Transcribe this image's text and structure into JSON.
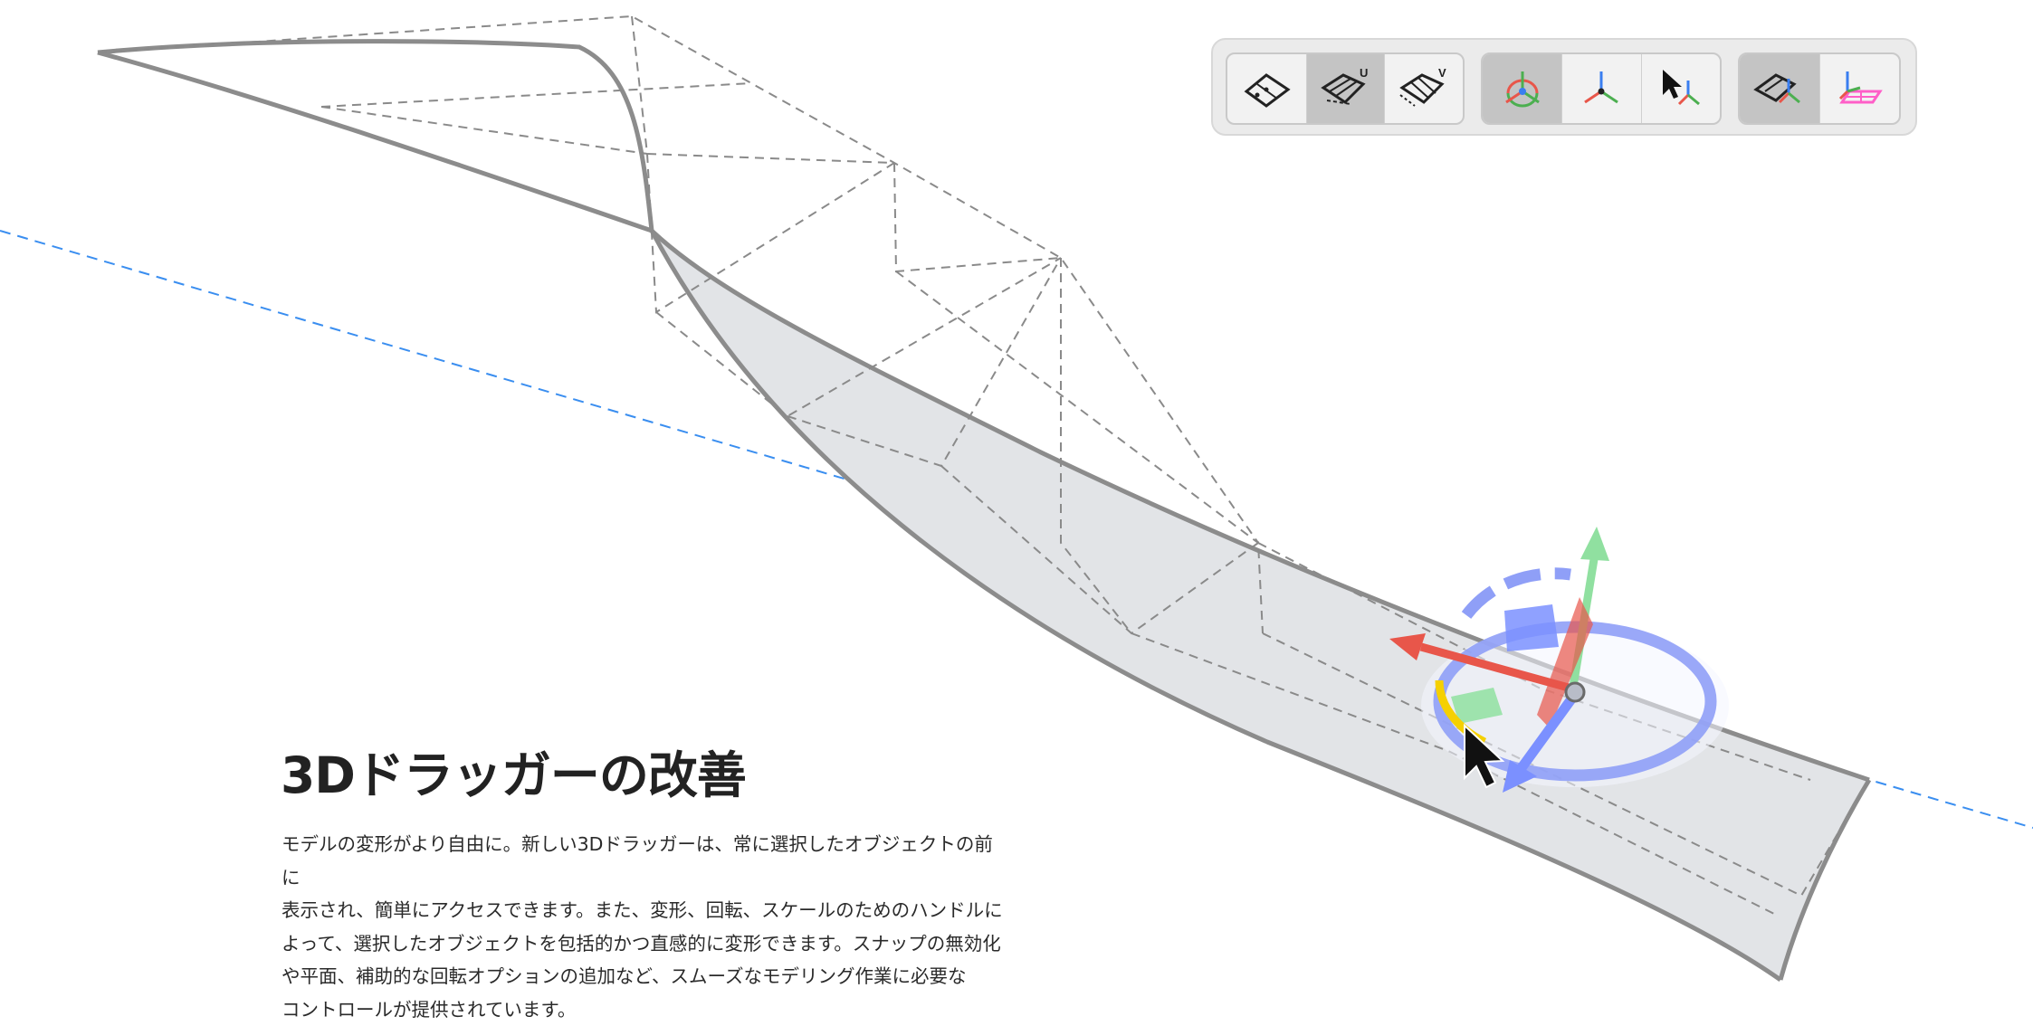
{
  "toolbar": {
    "groups": [
      {
        "name": "surface-edit",
        "buttons": [
          {
            "icon": "surface-control-points-icon",
            "active": false
          },
          {
            "icon": "surface-u-isocurve-icon",
            "active": true,
            "badge": "U"
          },
          {
            "icon": "surface-v-isocurve-icon",
            "active": false,
            "badge": "V"
          }
        ]
      },
      {
        "name": "gizmo-mode",
        "buttons": [
          {
            "icon": "full-gizmo-icon",
            "active": true
          },
          {
            "icon": "axis-gizmo-icon",
            "active": false
          },
          {
            "icon": "pointer-gizmo-icon",
            "active": false
          }
        ]
      },
      {
        "name": "gizmo-alignment",
        "buttons": [
          {
            "icon": "object-align-gizmo-icon",
            "active": true
          },
          {
            "icon": "plane-align-gizmo-icon",
            "active": false
          }
        ]
      }
    ]
  },
  "feature": {
    "title": "3Dドラッガーの改善",
    "description_lines": [
      "モデルの変形がより自由に。新しい3Dドラッガーは、常に選択したオブジェクトの前に",
      "表示され、簡単にアクセスできます。また、変形、回転、スケールのためのハンドルに",
      "よって、選択したオブジェクトを包括的かつ直感的に変形できます。スナップの無効化",
      "や平面、補助的な回転オプションの追加など、スムーズなモデリング作業に必要な",
      "コントロールが提供されています。"
    ]
  },
  "colors": {
    "surface_fill": "#e2e4e7",
    "surface_edge": "#8c8c8c",
    "cage_lines": "#8a8a8a",
    "guide_line": "#3a8ef0",
    "x_axis": "#e8564a",
    "y_axis": "#90e0a0",
    "z_axis": "#7b90ff",
    "rotation_ring": "#8f9ff7",
    "snap_arc": "#f5d000"
  }
}
